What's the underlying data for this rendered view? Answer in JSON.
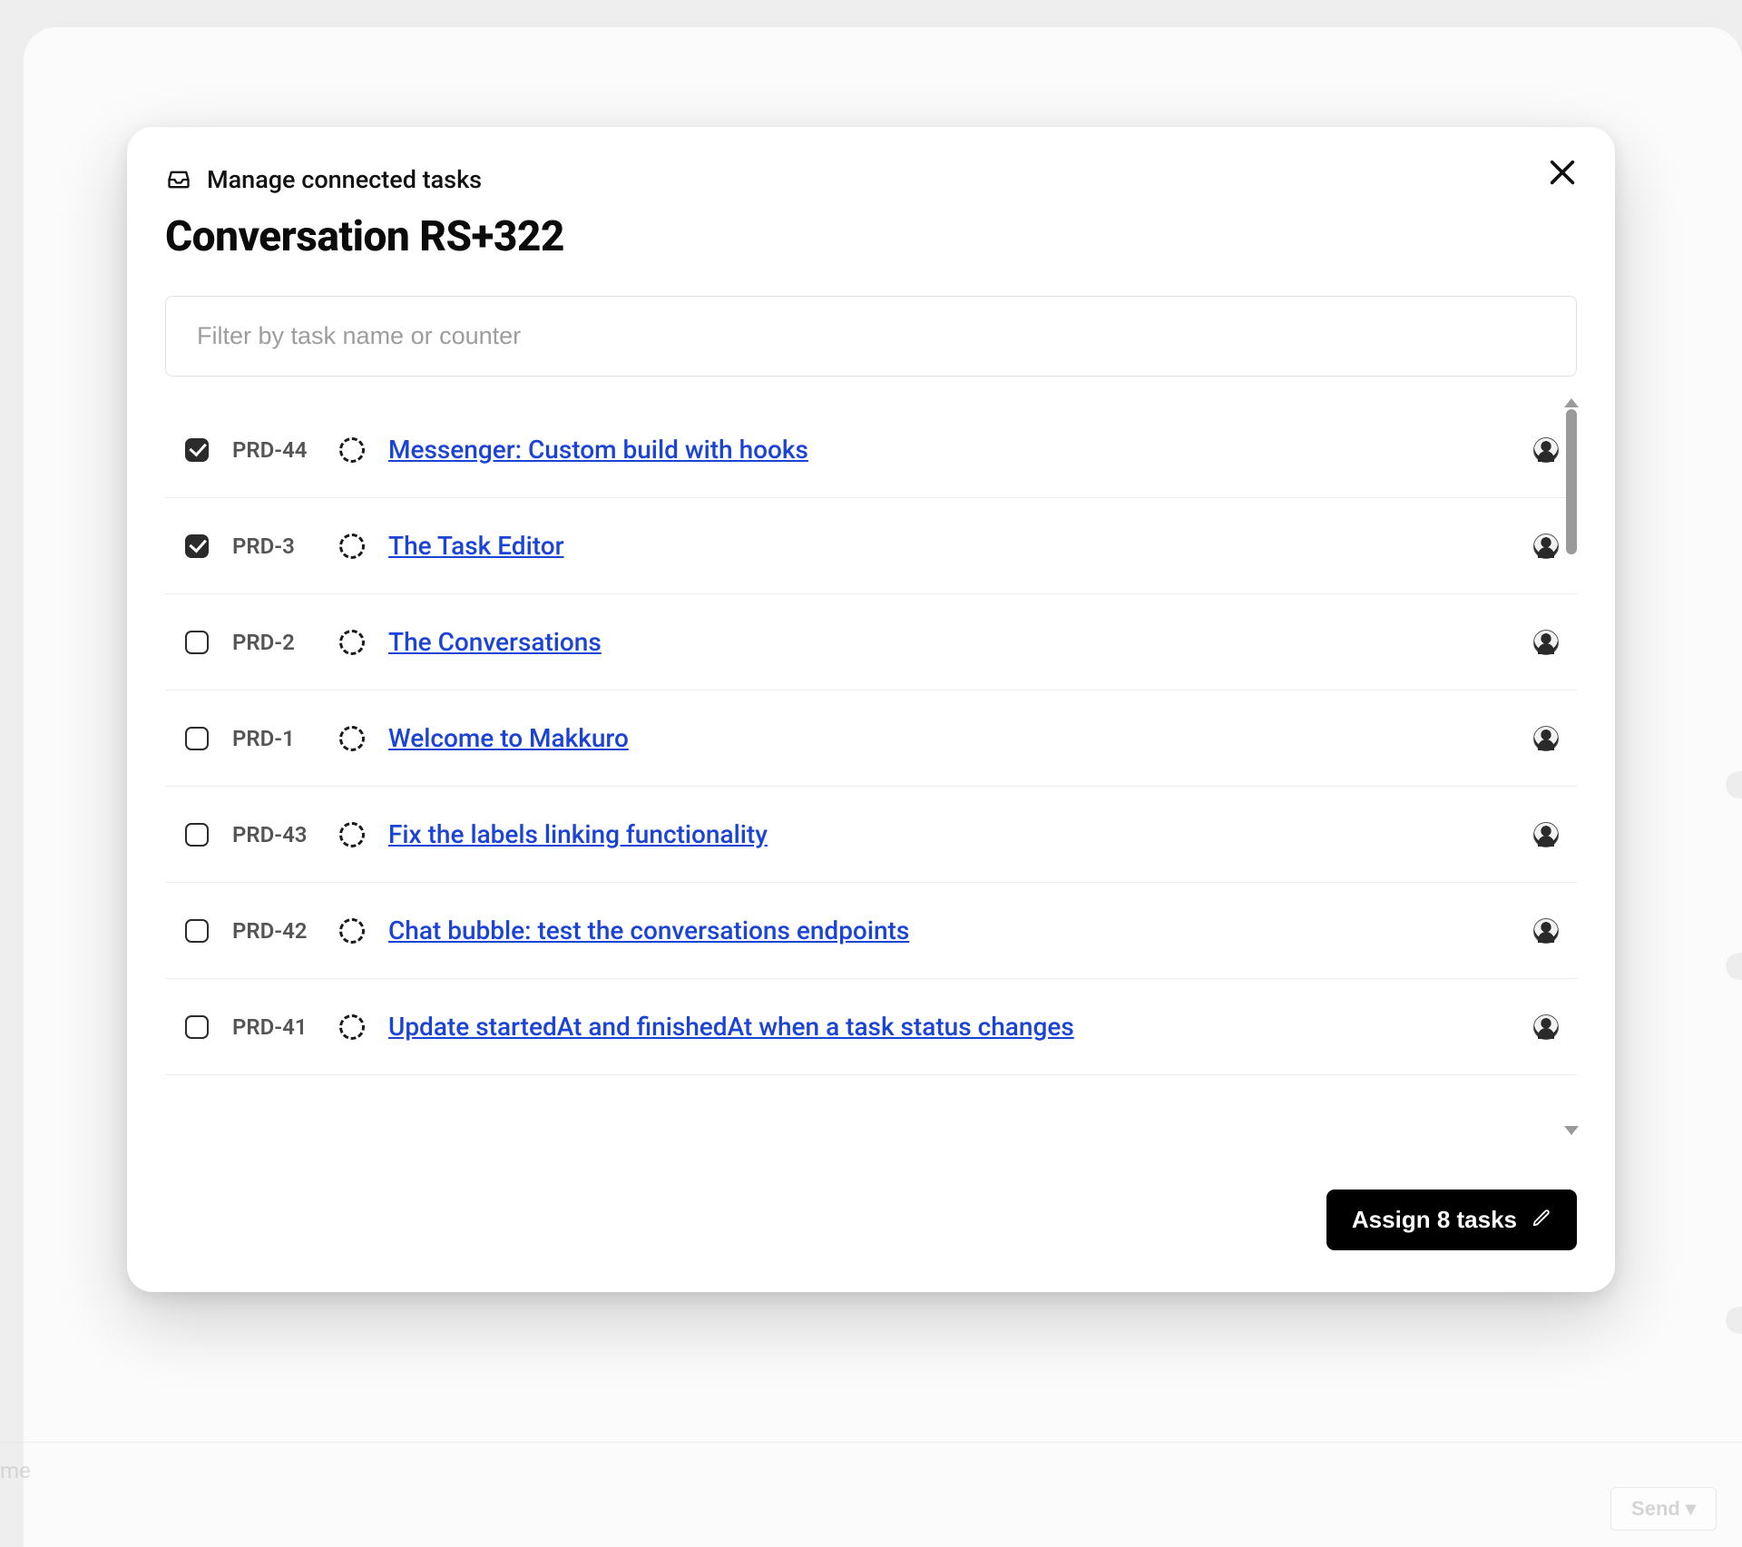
{
  "background": {
    "send_label": "Send ▾",
    "me_fragment": "me"
  },
  "modal": {
    "subtitle": "Manage connected tasks",
    "title": "Conversation RS+322",
    "filter_placeholder": "Filter by task name or counter",
    "assign_label": "Assign 8 tasks"
  },
  "tasks": [
    {
      "id": "PRD-44",
      "title": "Messenger: Custom build with hooks",
      "checked": true
    },
    {
      "id": "PRD-3",
      "title": "The Task Editor",
      "checked": true
    },
    {
      "id": "PRD-2",
      "title": "The Conversations",
      "checked": false
    },
    {
      "id": "PRD-1",
      "title": "Welcome to Makkuro",
      "checked": false
    },
    {
      "id": "PRD-43",
      "title": "Fix the labels linking functionality",
      "checked": false
    },
    {
      "id": "PRD-42",
      "title": "Chat bubble: test the conversations endpoints",
      "checked": false
    },
    {
      "id": "PRD-41",
      "title": "Update startedAt and finishedAt when a task status changes",
      "checked": false
    }
  ]
}
